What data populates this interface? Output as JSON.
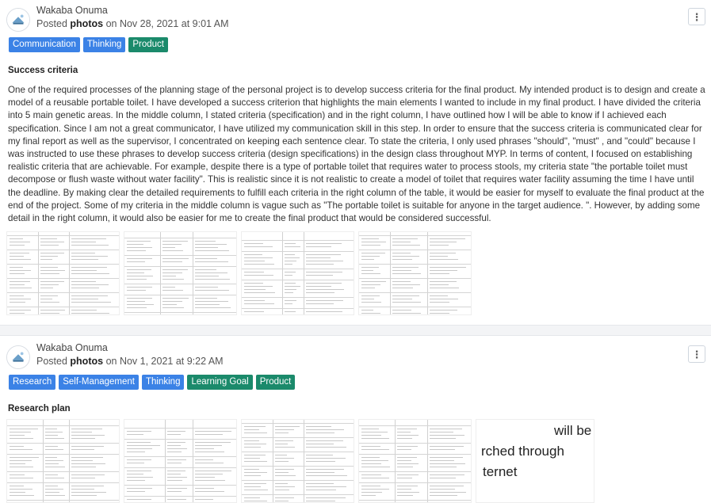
{
  "posts": [
    {
      "author": "Wakaba Onuma",
      "posted_prefix": "Posted",
      "posted_item": "photos",
      "posted_suffix": "on Nov 28, 2021 at 9:01 AM",
      "tags": [
        {
          "label": "Communication",
          "color": "#3b82e6"
        },
        {
          "label": "Thinking",
          "color": "#3b82e6"
        },
        {
          "label": "Product",
          "color": "#1b8a6b"
        }
      ],
      "section_title": "Success criteria",
      "body": "One of the required processes of the planning stage of the personal project is to develop success criteria for the final product. My intended product is to design and create a model of a reusable portable toilet. I have developed a success criterion that highlights the main elements I wanted to include in my final product. I have divided the criteria into 5 main genetic areas. In the middle column, I stated criteria (specification) and in the right column, I have outlined how I will be able to know if I achieved each specification. Since I am not a great communicator, I have utilized my communication skill in this step. In order to ensure that the success criteria is communicated clear for my final report as well as the supervisor, I concentrated on keeping each sentence clear. To state the criteria, I only used phrases \"should\", \"must\" , and \"could\" because I was instructed to use these phrases to develop success criteria (design specifications) in the design class throughout MYP. In terms of content, I focused on establishing realistic criteria that are achievable. For example, despite there is a type of portable toilet that requires water to process stools, my criteria state \"the portable toilet must decompose or flush waste without water facility\". This is realistic since it is not realistic to create a model of toilet that requires water facility assuming the time I have until the deadline. By making clear the detailed requirements to fulfill each criteria in the right column of the table, it would be easier for myself to evaluate the final product at the end of the project. Some of my criteria in the middle column is vague such as \"The portable toilet is suitable for anyone in the target audience. \". However, by adding some detail in the right column, it would also be easier for me to create the final product that would be considered successful."
    },
    {
      "author": "Wakaba Onuma",
      "posted_prefix": "Posted",
      "posted_item": "photos",
      "posted_suffix": "on Nov 1, 2021 at 9:22 AM",
      "tags": [
        {
          "label": "Research",
          "color": "#3b82e6"
        },
        {
          "label": "Self-Management",
          "color": "#3b82e6"
        },
        {
          "label": "Thinking",
          "color": "#3b82e6"
        },
        {
          "label": "Learning Goal",
          "color": "#1b8a6b"
        },
        {
          "label": "Product",
          "color": "#1b8a6b"
        }
      ],
      "section_title": "Research plan",
      "zoom_lines": [
        "will be",
        "rched through",
        "ternet"
      ]
    }
  ],
  "icons": {
    "menu": "kebab-menu-icon",
    "avatar": "avatar-icon"
  }
}
